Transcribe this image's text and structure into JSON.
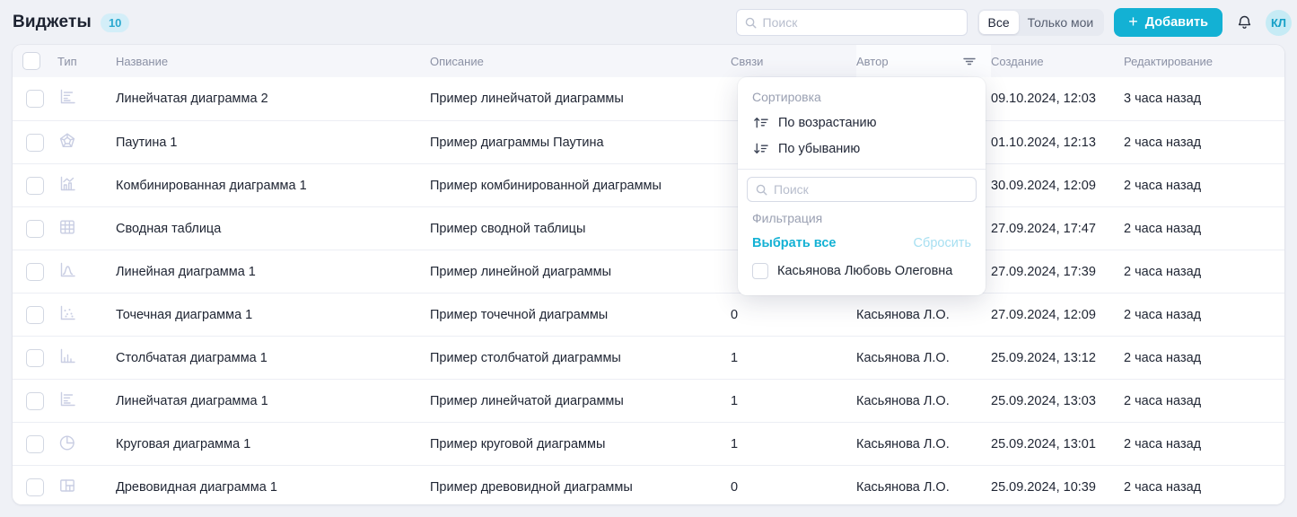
{
  "page": {
    "title": "Виджеты",
    "count_badge": "10"
  },
  "topbar": {
    "search_placeholder": "Поиск",
    "segmented": {
      "all_label": "Все",
      "only_mine_label": "Только мои",
      "selected": "Все"
    },
    "add_button_label": "Добавить",
    "avatar_initials": "КЛ"
  },
  "colors": {
    "accent_teal": "#13b1d4",
    "badge_bg": "#d3eef8",
    "avatar_bg": "#c6ebf5",
    "page_bg": "#eff1f6",
    "muted_header_text": "#8b91a5",
    "type_icon_color": "#c9cee3"
  },
  "table": {
    "columns": {
      "type": "Тип",
      "name": "Название",
      "description": "Описание",
      "links": "Связи",
      "author": "Автор",
      "created": "Создание",
      "edited": "Редактирование"
    },
    "rows": [
      {
        "icon": "bar-horizontal-chart-icon",
        "name": "Линейчатая диаграмма 2",
        "description": "Пример линейчатой диаграммы",
        "links": "",
        "author": "",
        "created": "09.10.2024, 12:03",
        "edited": "3 часа назад"
      },
      {
        "icon": "radar-chart-icon",
        "name": "Паутина 1",
        "description": "Пример диаграммы Паутина",
        "links": "",
        "author": "",
        "created": "01.10.2024, 12:13",
        "edited": "2 часа назад"
      },
      {
        "icon": "combo-chart-icon",
        "name": "Комбинированная диаграмма 1",
        "description": "Пример комбинированной диаграммы",
        "links": "",
        "author": "",
        "created": "30.09.2024, 12:09",
        "edited": "2 часа назад"
      },
      {
        "icon": "pivot-table-icon",
        "name": "Сводная таблица",
        "description": "Пример сводной таблицы",
        "links": "",
        "author": "",
        "created": "27.09.2024, 17:47",
        "edited": "2 часа назад"
      },
      {
        "icon": "line-chart-icon",
        "name": "Линейная диаграмма 1",
        "description": "Пример линейной диаграммы",
        "links": "",
        "author": "",
        "created": "27.09.2024, 17:39",
        "edited": "2 часа назад"
      },
      {
        "icon": "scatter-chart-icon",
        "name": "Точечная диаграмма 1",
        "description": "Пример точечной диаграммы",
        "links": "0",
        "author": "Касьянова Л.О.",
        "created": "27.09.2024, 12:09",
        "edited": "2 часа назад"
      },
      {
        "icon": "bar-vertical-chart-icon",
        "name": "Столбчатая диаграмма 1",
        "description": "Пример столбчатой диаграммы",
        "links": "1",
        "author": "Касьянова Л.О.",
        "created": "25.09.2024, 13:12",
        "edited": "2 часа назад"
      },
      {
        "icon": "bar-horizontal-chart-icon",
        "name": "Линейчатая диаграмма 1",
        "description": "Пример линейчатой диаграммы",
        "links": "1",
        "author": "Касьянова Л.О.",
        "created": "25.09.2024, 13:03",
        "edited": "2 часа назад"
      },
      {
        "icon": "pie-chart-icon",
        "name": "Круговая диаграмма 1",
        "description": "Пример круговой диаграммы",
        "links": "1",
        "author": "Касьянова Л.О.",
        "created": "25.09.2024, 13:01",
        "edited": "2 часа назад"
      },
      {
        "icon": "treemap-chart-icon",
        "name": "Древовидная диаграмма 1",
        "description": "Пример древовидной диаграммы",
        "links": "0",
        "author": "Касьянова Л.О.",
        "created": "25.09.2024, 10:39",
        "edited": "2 часа назад"
      }
    ]
  },
  "filter_popover": {
    "sort_label": "Сортировка",
    "sort_asc_label": "По возрастанию",
    "sort_desc_label": "По убыванию",
    "search_placeholder": "Поиск",
    "filter_label": "Фильтрация",
    "select_all_label": "Выбрать все",
    "reset_label": "Сбросить",
    "options": [
      {
        "label": "Касьянова Любовь Олеговна",
        "checked": false
      }
    ]
  }
}
